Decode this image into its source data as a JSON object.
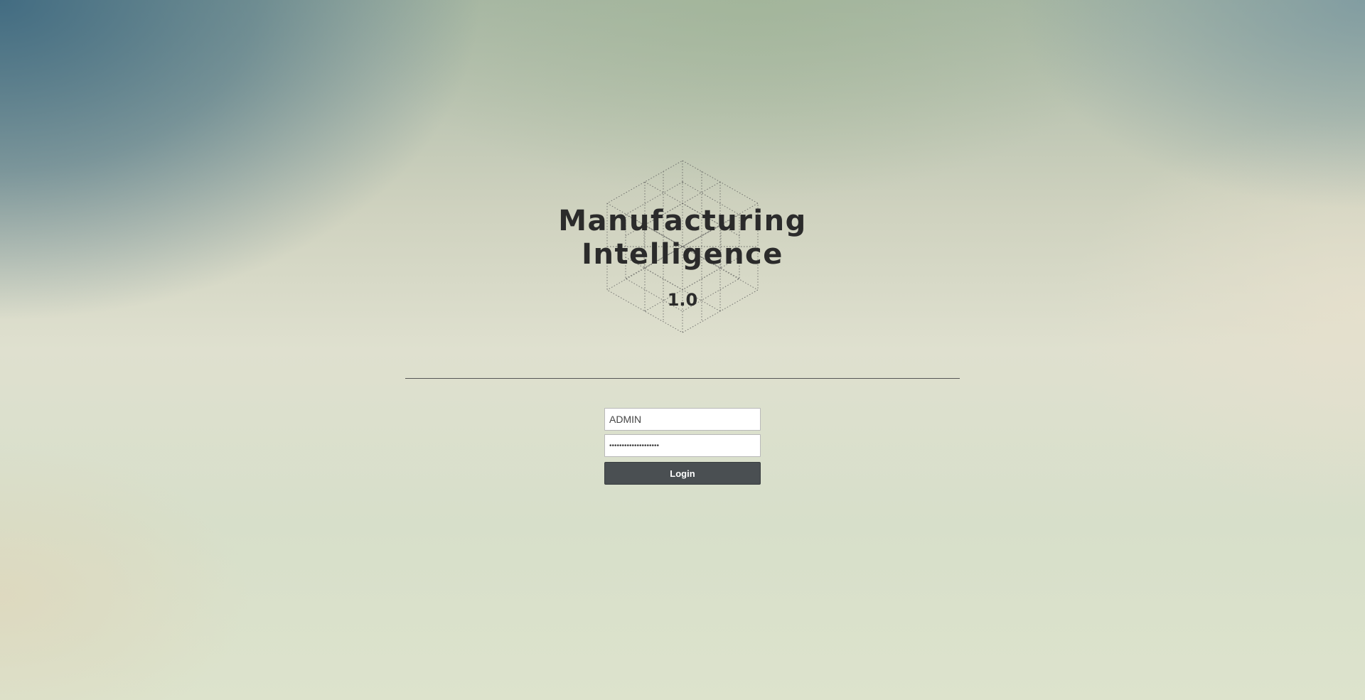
{
  "app": {
    "title_line1": "Manufacturing",
    "title_line2": "Intelligence",
    "version": "1.0",
    "emblem_icon": "geodesic-hexagon-icon"
  },
  "login_form": {
    "username_value": "ADMIN",
    "password_value": "••••••••••••••••••••",
    "login_label": "Login"
  },
  "colors": {
    "title_text": "#2b2b2b",
    "button_bg": "#4a4f52",
    "button_text": "#ffffff",
    "divider": "#555555"
  }
}
